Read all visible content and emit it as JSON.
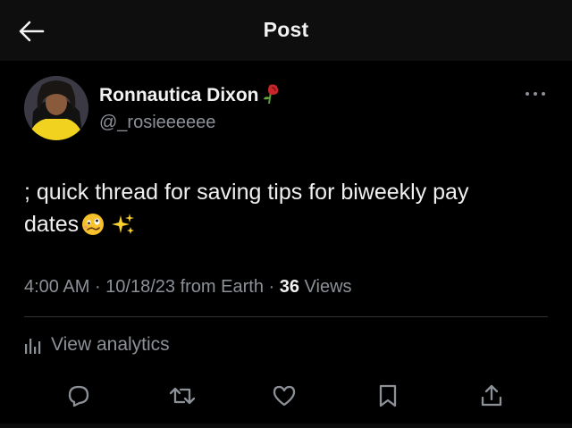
{
  "header": {
    "title": "Post",
    "back_icon": "arrow-left-icon"
  },
  "author": {
    "display_name": "Ronnautica Dixon",
    "name_emoji": "wilted-rose-emoji",
    "handle": "@_rosieeeeee"
  },
  "tweet": {
    "text_line1": "; quick thread for saving tips for biweekly pay",
    "text_line2": "dates",
    "emojis": [
      "face-with-uneven-eyes-emoji",
      "sparkles-emoji"
    ]
  },
  "meta": {
    "time": "4:00 AM",
    "sep1": " · ",
    "date": "10/18/23",
    "source": " from Earth",
    "sep2": " · ",
    "views_count": "36",
    "views_label": " Views"
  },
  "analytics": {
    "label": "View analytics"
  },
  "actions": [
    "reply-icon",
    "repost-icon",
    "like-icon",
    "bookmark-icon",
    "share-icon"
  ],
  "colors": {
    "background": "#000000",
    "text": "#e7e9ea",
    "muted": "#8b9197",
    "divider": "#2f3336"
  }
}
